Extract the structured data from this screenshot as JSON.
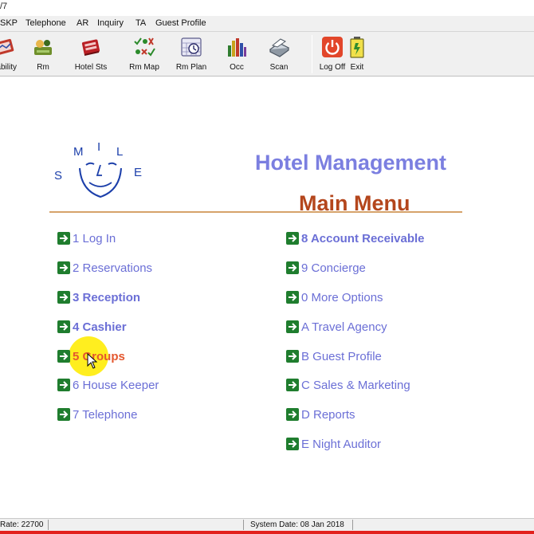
{
  "window": {
    "title_fragment": "/7"
  },
  "menubar": {
    "items": [
      {
        "label": "SKP"
      },
      {
        "label": "Telephone"
      },
      {
        "label": "AR"
      },
      {
        "label": "Inquiry"
      },
      {
        "label": "TA"
      },
      {
        "label": "Guest Profile"
      }
    ]
  },
  "toolbar": {
    "buttons": [
      {
        "label": "ilability",
        "icon": "availability-icon"
      },
      {
        "label": "Rm",
        "icon": "room-status-icon"
      },
      {
        "label": "Hotel Sts",
        "icon": "hotel-status-icon"
      },
      {
        "label": "Rm Map",
        "icon": "room-map-icon"
      },
      {
        "label": "Rm Plan",
        "icon": "room-plan-icon"
      },
      {
        "label": "Occ",
        "icon": "occupancy-chart-icon"
      },
      {
        "label": "Scan",
        "icon": "scanner-icon"
      },
      {
        "label": "Log Off",
        "icon": "power-icon"
      },
      {
        "label": "Exit",
        "icon": "battery-exit-icon"
      }
    ]
  },
  "logo": {
    "text": "SMILE",
    "letters": [
      "S",
      "M",
      "I",
      "L",
      "E"
    ]
  },
  "main": {
    "app_title": "Hotel Management",
    "menu_title": "Main Menu",
    "left_items": [
      {
        "label": "1 Log In",
        "bold": false
      },
      {
        "label": "2 Reservations",
        "bold": false
      },
      {
        "label": "3 Reception",
        "bold": true
      },
      {
        "label": "4 Cashier",
        "bold": true
      },
      {
        "label": "5 Groups",
        "bold": true
      },
      {
        "label": "6 House Keeper",
        "bold": false
      },
      {
        "label": "7 Telephone",
        "bold": false
      }
    ],
    "right_items": [
      {
        "label": "8 Account Receivable",
        "bold": true
      },
      {
        "label": "9 Concierge",
        "bold": false
      },
      {
        "label": "0 More Options",
        "bold": false
      },
      {
        "label": "A Travel Agency",
        "bold": false
      },
      {
        "label": "B Guest Profile",
        "bold": false
      },
      {
        "label": "C Sales & Marketing",
        "bold": false
      },
      {
        "label": "D Reports",
        "bold": false
      },
      {
        "label": "E Night Auditor",
        "bold": false
      }
    ],
    "hovered_item": "5 Groups"
  },
  "statusbar": {
    "rate": "Rate: 22700",
    "system_date": "System Date: 08 Jan 2018"
  },
  "colors": {
    "menu_text": "#6b6fd6",
    "app_title": "#7b7fe0",
    "menu_title": "#b4461c",
    "hover_text": "#e4572e",
    "arrow_bg": "#1f7d2e",
    "rule": "#d6a36a",
    "stripe": "#e2201c"
  }
}
